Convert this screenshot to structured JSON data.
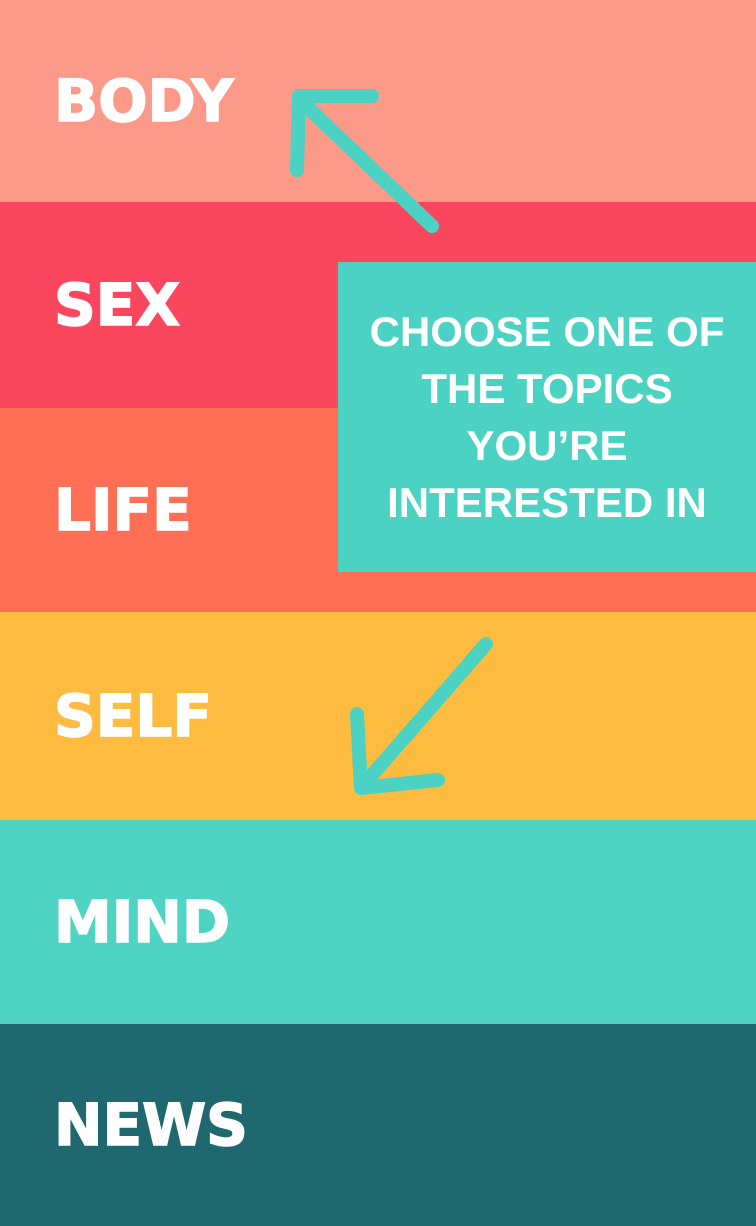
{
  "colors": {
    "body": "#fb9a89",
    "sex": "#fb475e",
    "life": "#fe6f55",
    "self": "#fdbc40",
    "mind": "#4fd3c3",
    "news": "#1f6870",
    "callout": "#4bd2c2",
    "arrow": "#4bd2c2"
  },
  "topics": [
    {
      "label": "BODY"
    },
    {
      "label": "SEX"
    },
    {
      "label": "LIFE"
    },
    {
      "label": "SELF"
    },
    {
      "label": "MIND"
    },
    {
      "label": "NEWS"
    }
  ],
  "callout": {
    "line1": "CHOOSE ONE OF",
    "line2": "THE TOPICS",
    "line3": "YOU’RE",
    "line4": "INTERESTED IN"
  },
  "icons": {
    "up_arrow": "arrow-up-left-icon",
    "down_arrow": "arrow-down-left-icon"
  }
}
